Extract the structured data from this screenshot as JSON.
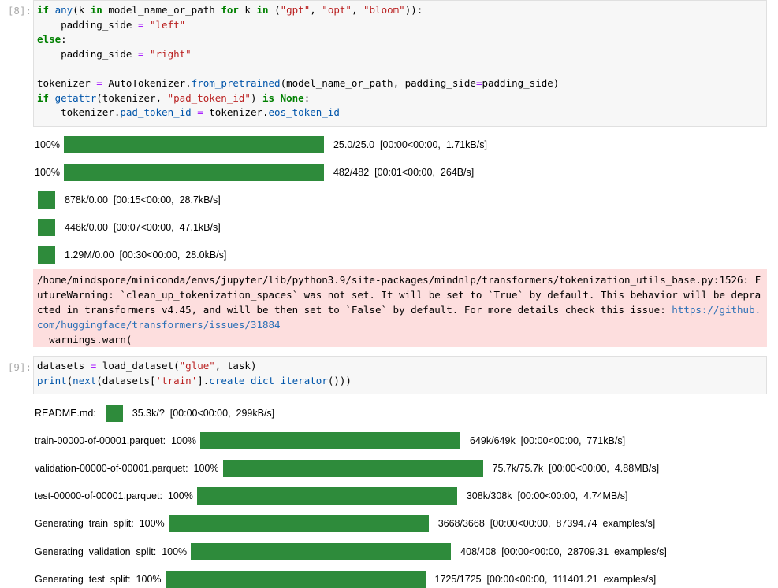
{
  "cells": [
    {
      "prompt": "[8]:",
      "code_lines": [
        [
          "if ",
          "any",
          "(k ",
          "in ",
          "model_name_or_path ",
          "for ",
          "k ",
          "in ",
          "(",
          "\"gpt\"",
          ", ",
          "\"opt\"",
          ", ",
          "\"bloom\"",
          ")):"
        ],
        [
          "    padding_side ",
          "= ",
          "\"left\""
        ],
        [
          "else",
          ":"
        ],
        [
          "    padding_side ",
          "= ",
          "\"right\""
        ],
        [
          ""
        ],
        [
          "tokenizer ",
          "= ",
          "AutoTokenizer.",
          "from_pretrained",
          "(model_name_or_path, padding_side",
          "=",
          "padding_side)"
        ],
        [
          "if ",
          "getattr",
          "(tokenizer, ",
          "\"pad_token_id\"",
          ") ",
          "is ",
          "None",
          ":"
        ],
        [
          "    tokenizer.",
          "pad_token_id ",
          "= ",
          "tokenizer.",
          "eos_token_id"
        ]
      ]
    },
    {
      "prompt": "[9]:",
      "code_lines": [
        [
          "datasets ",
          "= ",
          "load_dataset(",
          "\"glue\"",
          ", task)"
        ],
        [
          "print",
          "(",
          "next",
          "(datasets[",
          "'train'",
          "].",
          "create_dict_iterator",
          "()))"
        ]
      ]
    }
  ],
  "outputs_cell8": [
    {
      "prefix": "100%",
      "progress": 1.0,
      "status": "25.0/25.0  [00:00<00:00,  1.71kB/s]"
    },
    {
      "prefix": "100%",
      "progress": 1.0,
      "status": "482/482  [00:01<00:00,  264B/s]"
    },
    {
      "prefix": "",
      "progress": null,
      "status": "878k/0.00  [00:15<00:00,  28.7kB/s]"
    },
    {
      "prefix": "",
      "progress": null,
      "status": "446k/0.00  [00:07<00:00,  47.1kB/s]"
    },
    {
      "prefix": "",
      "progress": null,
      "status": "1.29M/0.00  [00:30<00:00,  28.0kB/s]"
    }
  ],
  "stderr": {
    "text": "/home/mindspore/miniconda/envs/jupyter/lib/python3.9/site-packages/mindnlp/transformers/tokenization_utils_base.py:1526: FutureWarning: `clean_up_tokenization_spaces` was not set. It will be set to `True` by default. This behavior will be depracted in transformers v4.45, and will be then set to `False` by default. For more details check this issue: ",
    "link": "https://github.com/huggingface/transformers/issues/31884",
    "tail": "  warnings.warn("
  },
  "outputs_cell9": [
    {
      "prefix": "README.md:",
      "progress": null,
      "status": "35.3k/?  [00:00<00:00,  299kB/s]"
    },
    {
      "prefix": "train-00000-of-00001.parquet:  100%",
      "progress": 1.0,
      "status": "649k/649k  [00:00<00:00,  771kB/s]"
    },
    {
      "prefix": "validation-00000-of-00001.parquet:  100%",
      "progress": 1.0,
      "status": "75.7k/75.7k  [00:00<00:00,  4.88MB/s]"
    },
    {
      "prefix": "test-00000-of-00001.parquet:  100%",
      "progress": 1.0,
      "status": "308k/308k  [00:00<00:00,  4.74MB/s]"
    },
    {
      "prefix": "Generating  train  split:  100%",
      "progress": 1.0,
      "status": "3668/3668  [00:00<00:00,  87394.74  examples/s]"
    },
    {
      "prefix": "Generating  validation  split:  100%",
      "progress": 1.0,
      "status": "408/408  [00:00<00:00,  28709.31  examples/s]"
    },
    {
      "prefix": "Generating  test  split:  100%",
      "progress": 1.0,
      "status": "1725/1725  [00:00<00:00,  111401.21  examples/s]"
    }
  ],
  "colors": {
    "progress_bar": "#2e8b3b",
    "stderr_bg": "#fddede",
    "code_bg": "#f7f7f7"
  }
}
